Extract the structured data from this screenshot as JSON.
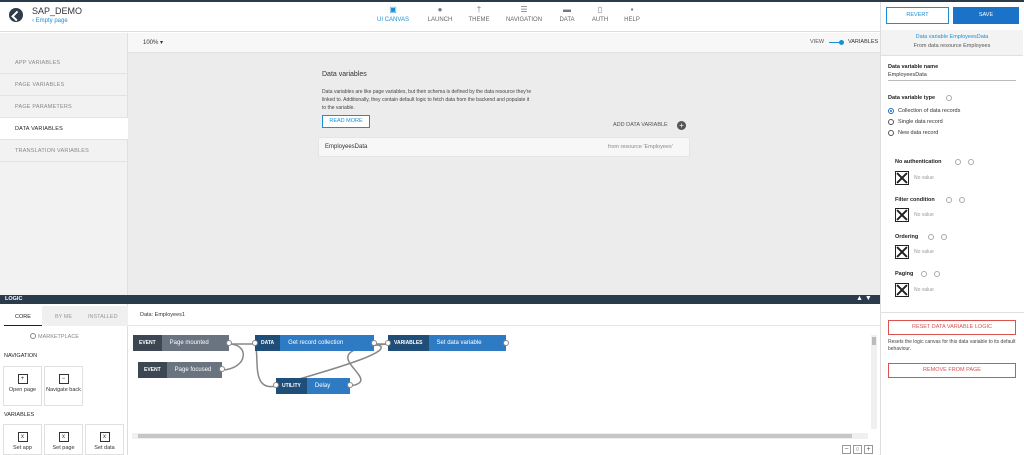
{
  "header": {
    "app_title": "SAP_DEMO",
    "page_name": "Empty page",
    "nav": [
      {
        "label": "UI CANVAS",
        "icon": "ui-canvas-icon"
      },
      {
        "label": "LAUNCH",
        "icon": "launch-icon"
      },
      {
        "label": "THEME",
        "icon": "theme-icon"
      },
      {
        "label": "NAVIGATION",
        "icon": "navigation-icon"
      },
      {
        "label": "DATA",
        "icon": "data-icon"
      },
      {
        "label": "AUTH",
        "icon": "auth-icon"
      },
      {
        "label": "HELP",
        "icon": "help-icon"
      }
    ],
    "accent_color": "#1c8fd0"
  },
  "left_tabs": [
    "APP VARIABLES",
    "PAGE VARIABLES",
    "PAGE PARAMETERS",
    "DATA VARIABLES",
    "TRANSLATION VARIABLES"
  ],
  "canvas": {
    "zoom": "100%",
    "view_label": "VIEW",
    "variables_label": "VARIABLES",
    "title": "Data variables",
    "description": "Data variables are like page variables, but their schema is defined by the data resource they're linked to. Additionally, they contain default logic to fetch data from the backend and populate it to the variable.",
    "read_more": "READ MORE",
    "add_variable": "ADD DATA VARIABLE",
    "variable_row": {
      "name": "EmployeesData",
      "source": "from resource 'Employees'"
    }
  },
  "right_panel": {
    "revert": "REVERT",
    "save": "SAVE",
    "head_title": "Data variable EmployeesData",
    "head_sub": "From data resource Employees",
    "name_label": "Data variable name",
    "name_value": "EmployeesData",
    "type_label": "Data variable type",
    "types": [
      "Collection of data records",
      "Single data record",
      "New data record"
    ],
    "sections": [
      "No authentication",
      "Filter condition",
      "Ordering",
      "Paging"
    ],
    "no_value": "No value",
    "reset_button": "RESET DATA VARIABLE LOGIC",
    "reset_desc": "Resets the logic canvas for this data variable to its default behaviour.",
    "remove_button": "REMOVE FROM PAGE"
  },
  "logic": {
    "bar_label": "LOGIC",
    "tabs": [
      "CORE",
      "BY ME",
      "INSTALLED"
    ],
    "marketplace": "MARKETPLACE",
    "section_navigation": "NAVIGATION",
    "section_variables": "VARIABLES",
    "nav_tiles": [
      "Open page",
      "Navigate back"
    ],
    "var_tiles": [
      "Set app",
      "Set page",
      "Set data"
    ],
    "canvas_title": "Data: Employees1",
    "nodes": [
      {
        "tag": "EVENT",
        "label": "Page mounted"
      },
      {
        "tag": "DATA",
        "label": "Get record collection"
      },
      {
        "tag": "VARIABLES",
        "label": "Set data variable"
      },
      {
        "tag": "EVENT",
        "label": "Page focused"
      },
      {
        "tag": "UTILITY",
        "label": "Delay"
      }
    ]
  }
}
